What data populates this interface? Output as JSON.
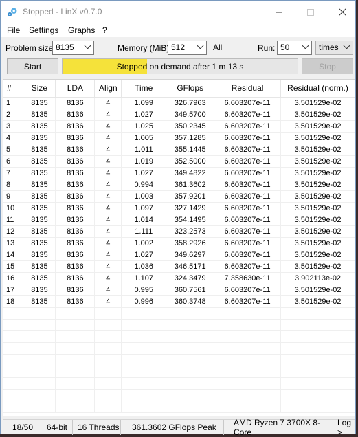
{
  "window": {
    "title": "Stopped - LinX v0.7.0"
  },
  "menu": [
    "File",
    "Settings",
    "Graphs",
    "?"
  ],
  "controls": {
    "problem_size_label": "Problem size:",
    "problem_size_value": "8135",
    "memory_label": "Memory (MiB):",
    "memory_value": "512",
    "all_label": "All",
    "run_label": "Run:",
    "run_value": "50",
    "run_unit": "times",
    "start_label": "Start",
    "stop_label": "Stop",
    "progress_text": "Stopped on demand after 1 m 13 s",
    "progress_fraction": 0.36
  },
  "table": {
    "headers": [
      "#",
      "Size",
      "LDA",
      "Align",
      "Time",
      "GFlops",
      "Residual",
      "Residual (norm.)"
    ],
    "rows": [
      [
        "1",
        "8135",
        "8136",
        "4",
        "1.099",
        "326.7963",
        "6.603207e-11",
        "3.501529e-02"
      ],
      [
        "2",
        "8135",
        "8136",
        "4",
        "1.027",
        "349.5700",
        "6.603207e-11",
        "3.501529e-02"
      ],
      [
        "3",
        "8135",
        "8136",
        "4",
        "1.025",
        "350.2345",
        "6.603207e-11",
        "3.501529e-02"
      ],
      [
        "4",
        "8135",
        "8136",
        "4",
        "1.005",
        "357.1285",
        "6.603207e-11",
        "3.501529e-02"
      ],
      [
        "5",
        "8135",
        "8136",
        "4",
        "1.011",
        "355.1445",
        "6.603207e-11",
        "3.501529e-02"
      ],
      [
        "6",
        "8135",
        "8136",
        "4",
        "1.019",
        "352.5000",
        "6.603207e-11",
        "3.501529e-02"
      ],
      [
        "7",
        "8135",
        "8136",
        "4",
        "1.027",
        "349.4822",
        "6.603207e-11",
        "3.501529e-02"
      ],
      [
        "8",
        "8135",
        "8136",
        "4",
        "0.994",
        "361.3602",
        "6.603207e-11",
        "3.501529e-02"
      ],
      [
        "9",
        "8135",
        "8136",
        "4",
        "1.003",
        "357.9201",
        "6.603207e-11",
        "3.501529e-02"
      ],
      [
        "10",
        "8135",
        "8136",
        "4",
        "1.097",
        "327.1429",
        "6.603207e-11",
        "3.501529e-02"
      ],
      [
        "11",
        "8135",
        "8136",
        "4",
        "1.014",
        "354.1495",
        "6.603207e-11",
        "3.501529e-02"
      ],
      [
        "12",
        "8135",
        "8136",
        "4",
        "1.111",
        "323.2573",
        "6.603207e-11",
        "3.501529e-02"
      ],
      [
        "13",
        "8135",
        "8136",
        "4",
        "1.002",
        "358.2926",
        "6.603207e-11",
        "3.501529e-02"
      ],
      [
        "14",
        "8135",
        "8136",
        "4",
        "1.027",
        "349.6297",
        "6.603207e-11",
        "3.501529e-02"
      ],
      [
        "15",
        "8135",
        "8136",
        "4",
        "1.036",
        "346.5171",
        "6.603207e-11",
        "3.501529e-02"
      ],
      [
        "16",
        "8135",
        "8136",
        "4",
        "1.107",
        "324.3479",
        "7.358630e-11",
        "3.902113e-02"
      ],
      [
        "17",
        "8135",
        "8136",
        "4",
        "0.995",
        "360.7561",
        "6.603207e-11",
        "3.501529e-02"
      ],
      [
        "18",
        "8135",
        "8136",
        "4",
        "0.996",
        "360.3748",
        "6.603207e-11",
        "3.501529e-02"
      ]
    ]
  },
  "status": {
    "progress": "18/50",
    "arch": "64-bit",
    "threads": "16 Threads",
    "peak": "361.3602 GFlops Peak",
    "cpu": "AMD Ryzen 7 3700X 8-Core",
    "log": "Log >"
  },
  "colors": {
    "progress_fill": "#f5e23a",
    "window_border": "#7a9abf"
  }
}
